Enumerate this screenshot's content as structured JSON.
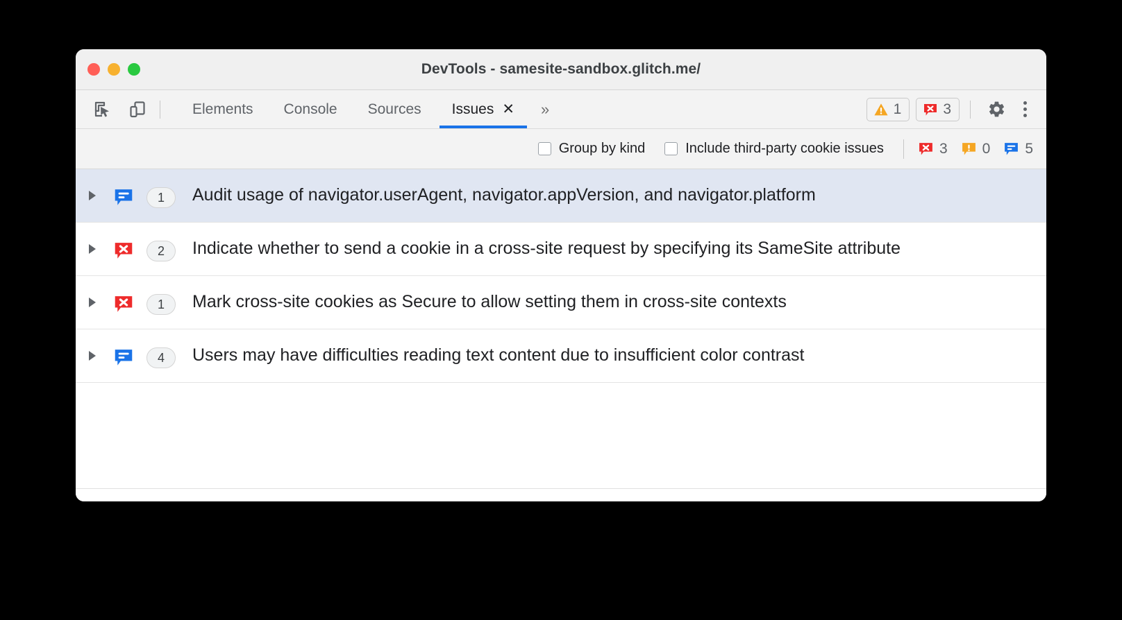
{
  "window": {
    "title": "DevTools - samesite-sandbox.glitch.me/",
    "traffic_lights": {
      "close": "close-button",
      "minimize": "minimize-button",
      "maximize": "maximize-button"
    }
  },
  "toolbar": {
    "inspect_icon": "inspect-element-icon",
    "device_icon": "device-toolbar-icon",
    "tabs": [
      {
        "label": "Elements",
        "active": false
      },
      {
        "label": "Console",
        "active": false
      },
      {
        "label": "Sources",
        "active": false
      },
      {
        "label": "Issues",
        "active": true,
        "close_label": "✕"
      }
    ],
    "overflow_label": "»",
    "warning_count": "1",
    "error_count": "3",
    "settings_icon": "gear-icon",
    "more_icon": "kebab-menu-icon"
  },
  "filters": {
    "group_by_kind": {
      "label": "Group by kind",
      "checked": false
    },
    "include_third_party": {
      "label": "Include third-party cookie issues",
      "checked": false
    },
    "counts": {
      "errors": "3",
      "warnings": "0",
      "info": "5"
    }
  },
  "issues": [
    {
      "kind": "info",
      "count": "1",
      "title": "Audit usage of navigator.userAgent, navigator.appVersion, and navigator.platform",
      "selected": true
    },
    {
      "kind": "error",
      "count": "2",
      "title": "Indicate whether to send a cookie in a cross-site request by specifying its SameSite attribute",
      "selected": false
    },
    {
      "kind": "error",
      "count": "1",
      "title": "Mark cross-site cookies as Secure to allow setting them in cross-site contexts",
      "selected": false
    },
    {
      "kind": "info",
      "count": "4",
      "title": "Users may have difficulties reading text content due to insufficient color contrast",
      "selected": false
    }
  ],
  "colors": {
    "accent": "#1a73e8",
    "error": "#ee2b2b",
    "warning": "#f5a623",
    "info": "#1a73e8",
    "selected_row": "#e0e6f2"
  }
}
